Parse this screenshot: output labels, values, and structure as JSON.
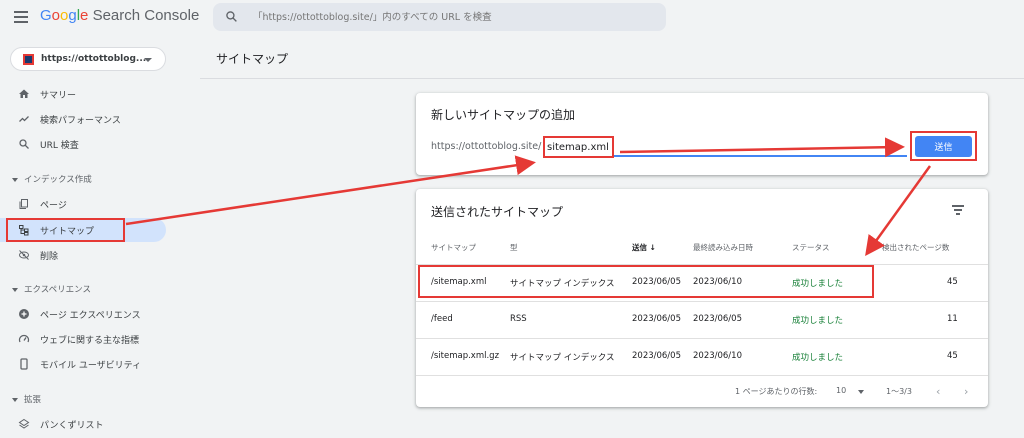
{
  "header": {
    "logo_google": "Google",
    "logo_rest": "Search Console",
    "search_placeholder": "「https://ottottoblog.site/」内のすべての URL を検査"
  },
  "sidebar": {
    "property": "https://ottottoblog....",
    "items_top": [
      {
        "label": "サマリー",
        "icon": "home-icon"
      },
      {
        "label": "検索パフォーマンス",
        "icon": "trending-up-icon"
      },
      {
        "label": "URL 検査",
        "icon": "search-icon"
      }
    ],
    "section_index": "インデックス作成",
    "items_index": [
      {
        "label": "ページ",
        "icon": "pages-icon"
      },
      {
        "label": "サイトマップ",
        "icon": "sitemap-icon"
      },
      {
        "label": "削除",
        "icon": "visibility-off-icon"
      }
    ],
    "section_experience": "エクスペリエンス",
    "items_experience": [
      {
        "label": "ページ エクスペリエンス",
        "icon": "add-circle-icon"
      },
      {
        "label": "ウェブに関する主な指標",
        "icon": "speed-icon"
      },
      {
        "label": "モバイル ユーザビリティ",
        "icon": "mobile-icon"
      }
    ],
    "section_enhancements": "拡張",
    "items_enhancements": [
      {
        "label": "パンくずリスト",
        "icon": "layers-icon"
      }
    ]
  },
  "main": {
    "page_title": "サイトマップ",
    "add_card": {
      "title": "新しいサイトマップの追加",
      "url_prefix": "https://ottottoblog.site/",
      "input_value": "sitemap.xml",
      "submit_label": "送信"
    },
    "submitted_card": {
      "title": "送信されたサイトマップ",
      "columns": [
        "サイトマップ",
        "型",
        "送信",
        "最終読み込み日時",
        "ステータス",
        "検出されたページ数"
      ],
      "rows": [
        [
          "/sitemap.xml",
          "サイトマップ インデックス",
          "2023/06/05",
          "2023/06/10",
          "成功しました",
          "45"
        ],
        [
          "/feed",
          "RSS",
          "2023/06/05",
          "2023/06/05",
          "成功しました",
          "11"
        ],
        [
          "/sitemap.xml.gz",
          "サイトマップ インデックス",
          "2023/06/05",
          "2023/06/10",
          "成功しました",
          "45"
        ]
      ],
      "footer": {
        "rows_per_page_label": "1 ページあたりの行数:",
        "rows_per_page_value": "10",
        "range": "1～3/3"
      }
    }
  },
  "colors": {
    "accent_blue": "#4285f4",
    "annotation_red": "#e53935",
    "success_green": "#188038",
    "active_nav": "#d2e3fc"
  }
}
